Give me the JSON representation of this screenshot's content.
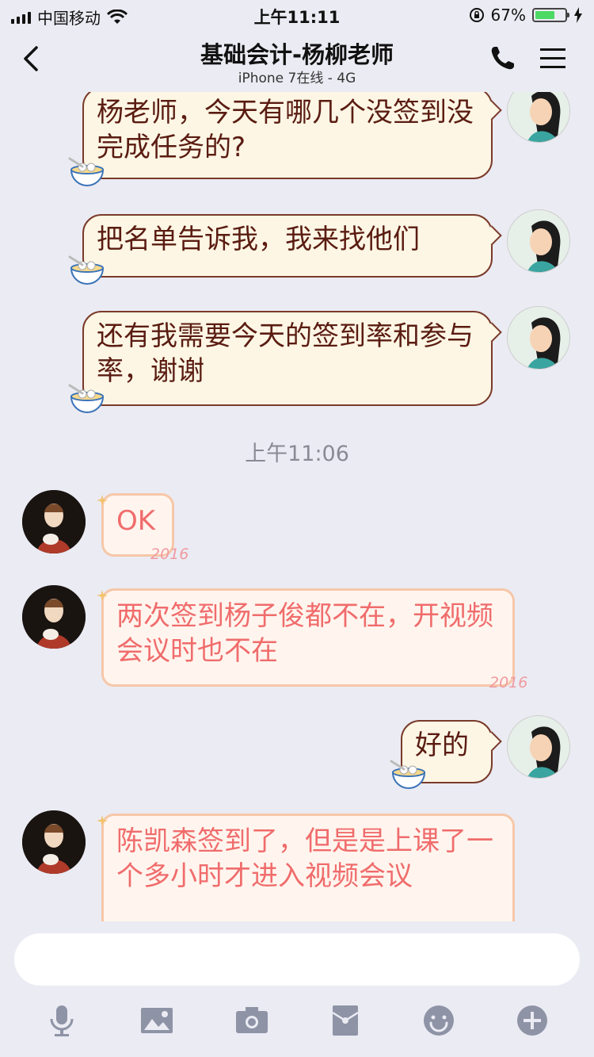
{
  "status_bar": {
    "carrier": "中国移动",
    "time": "上午11:11",
    "battery_percent": "67%",
    "battery_level": 0.67
  },
  "nav": {
    "title": "基础会计-杨柳老师",
    "subtitle": "iPhone 7在线 - 4G"
  },
  "messages": [
    {
      "side": "right",
      "text": "杨老师，今天有哪几个没签到没完成任务的?"
    },
    {
      "side": "right",
      "text": "把名单告诉我，我来找他们"
    },
    {
      "side": "right",
      "text": "还有我需要今天的签到率和参与率，谢谢"
    },
    {
      "side": "left",
      "text": "OK"
    },
    {
      "side": "left",
      "text": "两次签到杨子俊都不在，开视频会议时也不在"
    },
    {
      "side": "right",
      "text": "好的"
    },
    {
      "side": "left",
      "text": "陈凯森签到了，但是是上课了一个多小时才进入视频会议"
    }
  ],
  "timestamp": "上午11:06",
  "bubble_decoration": "2016",
  "composer": {
    "input_value": "",
    "tools": [
      "microphone-icon",
      "image-icon",
      "camera-icon",
      "red-packet-icon",
      "emoji-icon",
      "plus-icon"
    ]
  },
  "colors": {
    "background": "#ebebf3",
    "my_bubble_text": "#5a1c12",
    "their_bubble_text": "#f06c6c",
    "battery": "#4cd964"
  }
}
